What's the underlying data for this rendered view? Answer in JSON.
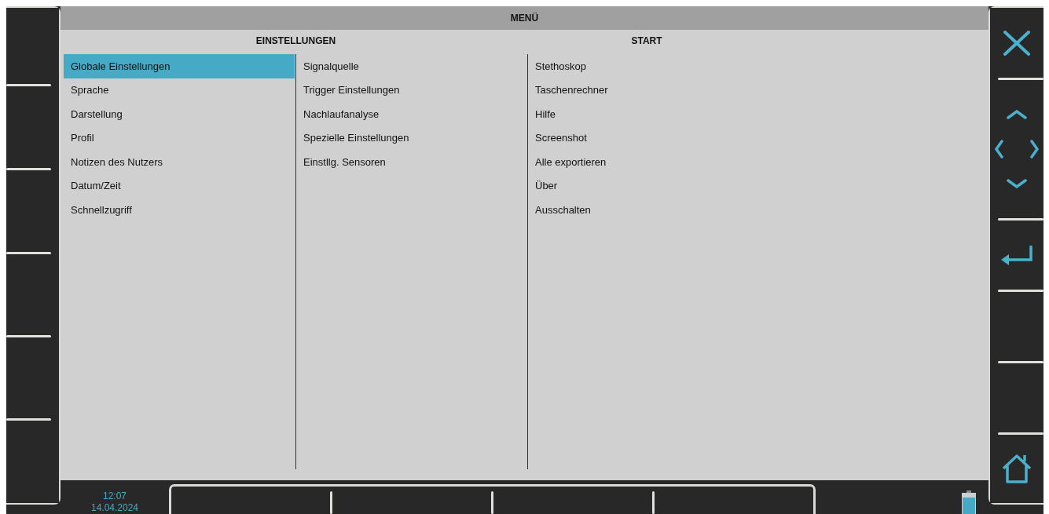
{
  "window": {
    "title": "MENÜ"
  },
  "sections": [
    {
      "heading": "EINSTELLUNGEN",
      "columns": [
        [
          {
            "label": "Globale Einstellungen",
            "selected": true
          },
          {
            "label": "Sprache",
            "selected": false
          },
          {
            "label": "Darstellung",
            "selected": false
          },
          {
            "label": "Profil",
            "selected": false
          },
          {
            "label": "Notizen des Nutzers",
            "selected": false
          },
          {
            "label": "Datum/Zeit",
            "selected": false
          },
          {
            "label": "Schnellzugriff",
            "selected": false
          }
        ],
        [
          {
            "label": "Signalquelle",
            "selected": false
          },
          {
            "label": "Trigger Einstellungen",
            "selected": false
          },
          {
            "label": "Nachlaufanalyse",
            "selected": false
          },
          {
            "label": "Spezielle Einstellungen",
            "selected": false
          },
          {
            "label": "Einstllg. Sensoren",
            "selected": false
          }
        ]
      ]
    },
    {
      "heading": "START",
      "columns": [
        [
          {
            "label": "Stethoskop",
            "selected": false
          },
          {
            "label": "Taschenrechner",
            "selected": false
          },
          {
            "label": "Hilfe",
            "selected": false
          },
          {
            "label": "Screenshot",
            "selected": false
          },
          {
            "label": "Alle exportieren",
            "selected": false
          },
          {
            "label": "Über",
            "selected": false
          },
          {
            "label": "Ausschalten",
            "selected": false
          }
        ]
      ]
    }
  ],
  "status_bar": {
    "time": "12:07",
    "date": "14.04.2024"
  }
}
